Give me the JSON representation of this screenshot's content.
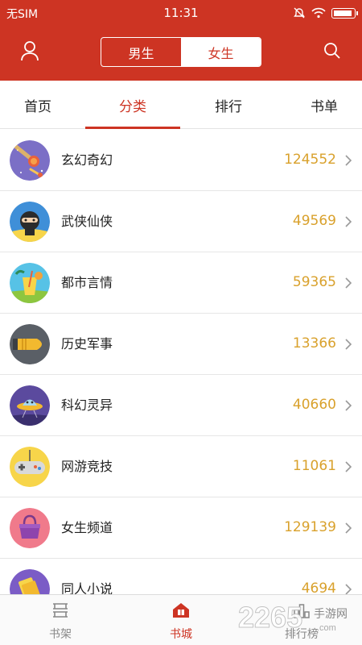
{
  "status": {
    "carrier": "无SIM",
    "time": "11:31"
  },
  "header": {
    "gender_options": [
      "男生",
      "女生"
    ],
    "selected_gender": "女生"
  },
  "tabs": [
    {
      "label": "首页",
      "active": false
    },
    {
      "label": "分类",
      "active": true
    },
    {
      "label": "排行",
      "active": false
    },
    {
      "label": "书单",
      "active": false
    }
  ],
  "categories": [
    {
      "name": "玄幻奇幻",
      "count": "124552",
      "icon": "meteor-icon"
    },
    {
      "name": "武侠仙侠",
      "count": "49569",
      "icon": "ninja-icon"
    },
    {
      "name": "都市言情",
      "count": "59365",
      "icon": "cocktail-icon"
    },
    {
      "name": "历史军事",
      "count": "13366",
      "icon": "bullet-icon"
    },
    {
      "name": "科幻灵异",
      "count": "40660",
      "icon": "ufo-icon"
    },
    {
      "name": "网游竞技",
      "count": "11061",
      "icon": "gamepad-icon"
    },
    {
      "name": "女生频道",
      "count": "129139",
      "icon": "handbag-icon"
    },
    {
      "name": "同人小说",
      "count": "4694",
      "icon": "book-icon"
    }
  ],
  "bottom_nav": [
    {
      "label": "书架",
      "icon": "bookshelf-icon",
      "active": false
    },
    {
      "label": "书城",
      "icon": "bookstore-icon",
      "active": true
    },
    {
      "label": "排行榜",
      "icon": "ranking-icon",
      "active": false
    }
  ],
  "watermark": {
    "brand": "2265",
    "site": "手游网",
    "url_text": ".com"
  },
  "colors": {
    "accent": "#cd3423",
    "count": "#d9a12c"
  }
}
